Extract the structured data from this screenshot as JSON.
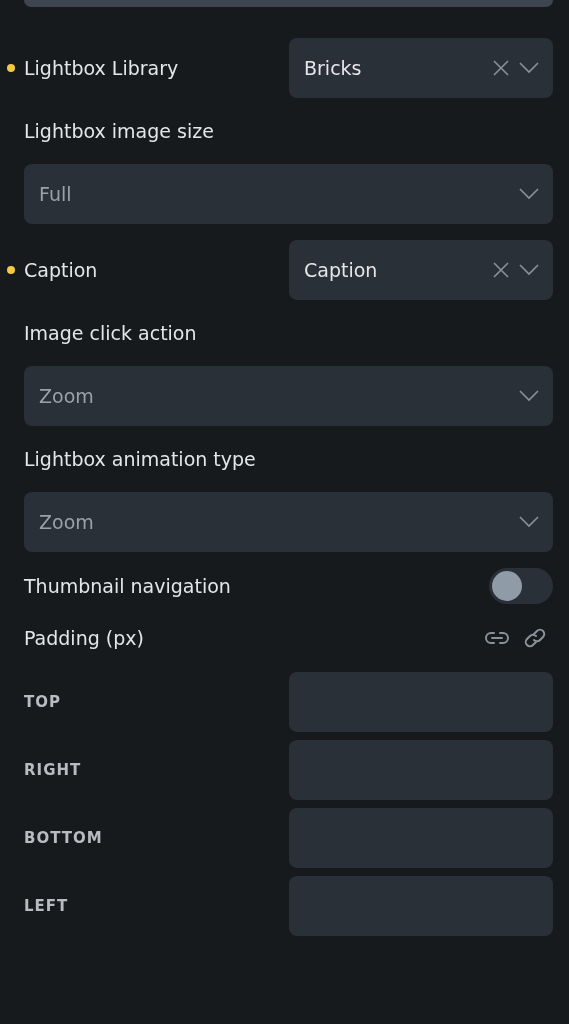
{
  "fields": [
    {
      "kind": "inline-select",
      "label": "Lightbox Library",
      "modified": true,
      "value": "Bricks",
      "clearable": true
    },
    {
      "kind": "select",
      "label": "Lightbox image size",
      "placeholder": "Full"
    },
    {
      "kind": "inline-select",
      "label": "Caption",
      "modified": true,
      "value": "Caption",
      "clearable": true
    },
    {
      "kind": "select",
      "label": "Image click action",
      "placeholder": "Zoom"
    },
    {
      "kind": "select",
      "label": "Lightbox animation type",
      "placeholder": "Zoom"
    },
    {
      "kind": "toggle",
      "label": "Thumbnail navigation",
      "on": false
    }
  ],
  "padding": {
    "label": "Padding (px)",
    "sides": [
      {
        "label": "TOP"
      },
      {
        "label": "RIGHT"
      },
      {
        "label": "BOTTOM"
      },
      {
        "label": "LEFT"
      }
    ]
  }
}
